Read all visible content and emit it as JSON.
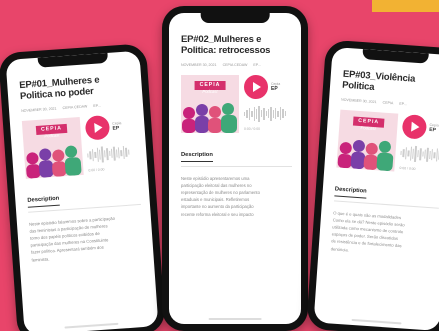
{
  "brand": {
    "background": "#e8456a",
    "accent": "#f2b233",
    "play_color": "#e8326a",
    "logo_color": "#d42f6c"
  },
  "phones": [
    {
      "title": "EP#01_Mulheres e Politica no poder",
      "meta": [
        "NOVEMBER 30, 2021",
        "CEPIA CEDAW",
        "EP..."
      ],
      "cover_logo": "CEPIA",
      "cover_subtitle": "Podcast",
      "episode_label": "EP",
      "episode_sub": "Cepia",
      "time": "0:00 / 0:00",
      "tab": "Description",
      "description": [
        "Neste episódio falaremos sobre a participação",
        "das feministas a participação de mulheres",
        "torno dos papéis políticos exibidos de",
        "participação das mulheres na Constituinte",
        "fazer política. Apresentará também dos",
        "feminista."
      ]
    },
    {
      "title": "EP#02_Mulheres e Politica: retrocessos",
      "meta": [
        "NOVEMBER 30, 2021",
        "CEPIA CEDAW",
        "EP..."
      ],
      "cover_logo": "CEPIA",
      "cover_subtitle": "Podcast",
      "episode_label": "EP",
      "episode_sub": "Cepia",
      "time": "0:00 / 0:00",
      "tab": "Description",
      "description": [
        "Neste episódio apresentaremos uma",
        "participação eleitoral das mulheres no",
        "representação de mulheres no parlamento",
        "estaduais e municipais. Refletiremos",
        "importante no aumento da participação",
        "recente reforma eleitoral e seu impacto"
      ]
    },
    {
      "title": "EP#03_Violência Politica",
      "meta": [
        "NOVEMBER 30, 2021",
        "CEPIA",
        "EP..."
      ],
      "cover_logo": "CEPIA",
      "cover_subtitle": "Podcast",
      "episode_label": "EP",
      "episode_sub": "Cepia",
      "time": "0:00 / 0:00",
      "tab": "Description",
      "description": [
        "O que é e quais são as modalidades",
        "Como ela se dá? Neste episódio serão",
        "utilizada como mecanismo de controle",
        "espaços de poder. Serão discutidas",
        "de resistência e de fortalecimento das",
        "denúncia."
      ]
    }
  ]
}
